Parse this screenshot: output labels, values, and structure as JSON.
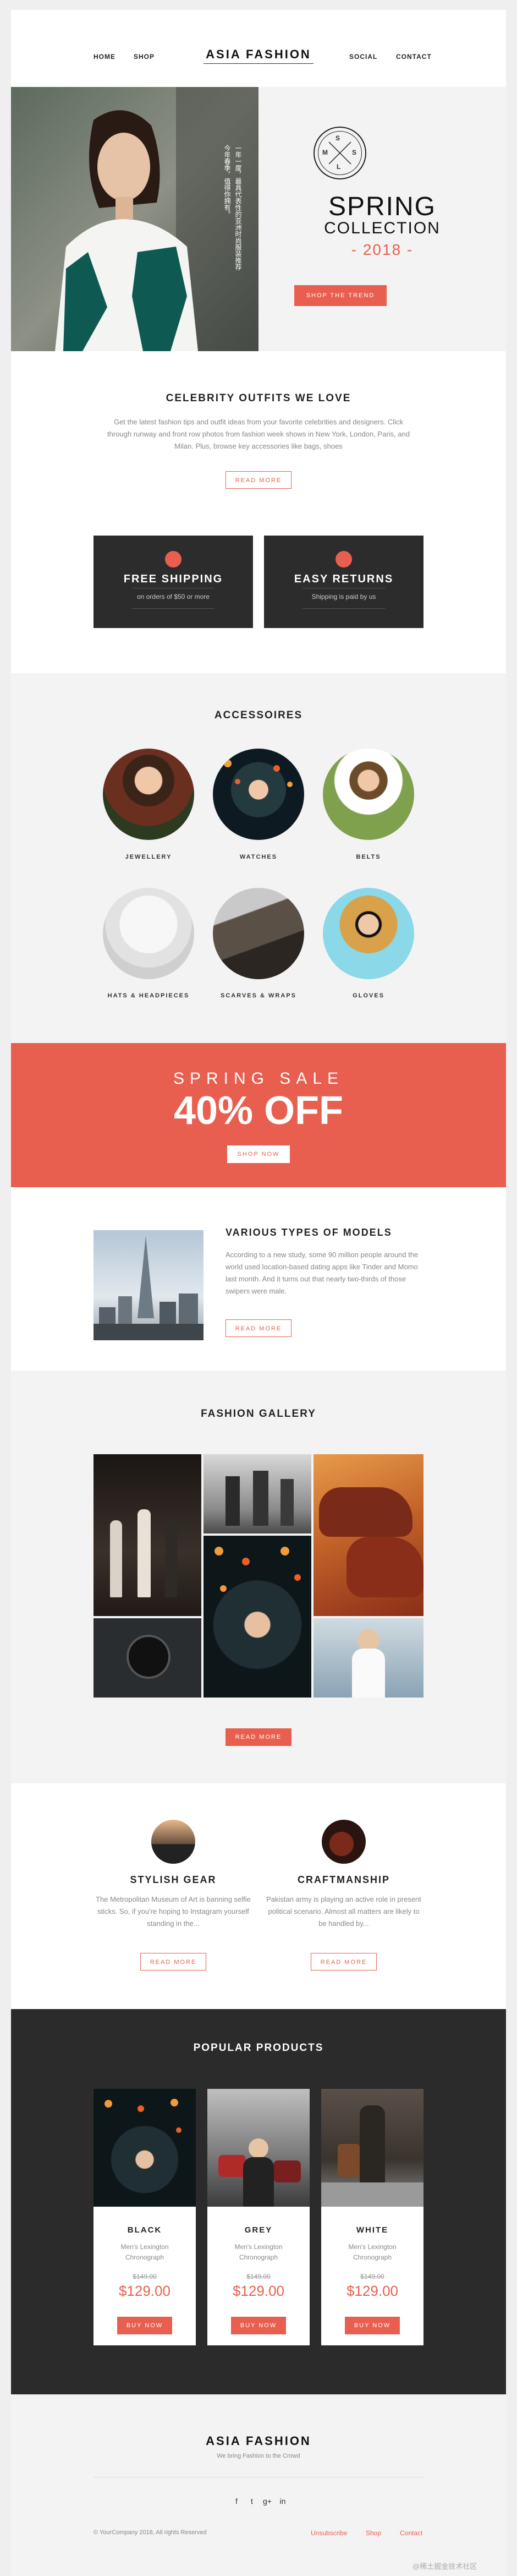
{
  "header": {
    "brand": "ASIA FASHION",
    "nav_left": [
      "HOME",
      "SHOP"
    ],
    "nav_right": [
      "SOCIAL",
      "CONTACT"
    ]
  },
  "hero": {
    "vertical_text_1": "一年一度，最具代表性的亚洲时尚服装推荐",
    "vertical_text_2": "今年春季，值得你拥有。",
    "logo_letters": [
      "S",
      "M",
      "S",
      "L"
    ],
    "title_1": "SPRING",
    "title_2": "COLLECTION",
    "year": "- 2018 -",
    "button": "SHOP THE TREND"
  },
  "celebrity": {
    "title": "CELEBRITY OUTFITS WE LOVE",
    "text": "Get the latest fashion tips and outfit ideas from your favorite celebrities and designers. Click through runway and front row photos from fashion week shows in New York, London, Paris, and Milan. Plus, browse key accessories like bags, shoes",
    "button": "READ MORE"
  },
  "features": [
    {
      "title": "FREE SHIPPING",
      "subtitle": "on orders of $50 or more"
    },
    {
      "title": "EASY RETURNS",
      "subtitle": "Shipping is paid by us"
    }
  ],
  "accessories": {
    "title": "ACCESSOIRES",
    "items": [
      "JEWELLERY",
      "WATCHES",
      "BELTS",
      "HATS & HEADPIECES",
      "SCARVES & WRAPS",
      "GLOVES"
    ]
  },
  "sale": {
    "label": "SPRING SALE",
    "headline": "40% OFF",
    "button": "SHOP NOW"
  },
  "models": {
    "title": "VARIOUS TYPES OF MODELS",
    "text": "According to a new study, some 90 million people around the world used location-based dating apps like Tinder and Momo last month. And it turns out that nearly two-thirds of those swipers were male.",
    "button": "READ MORE"
  },
  "gallery": {
    "title": "FASHION GALLERY",
    "button": "READ MORE"
  },
  "columns": [
    {
      "title": "STYLISH GEAR",
      "text": "The Metropolitan Museum of Art is banning selfie sticks. So, if you're hoping to Instagram yourself standing in the...",
      "button": "READ MORE"
    },
    {
      "title": "CRAFTMANSHIP",
      "text": "Pakistan army is playing an active role in present political scenario. Almost all matters are likely to be handled by...",
      "button": "READ MORE"
    }
  ],
  "products": {
    "title": "POPULAR PRODUCTS",
    "items": [
      {
        "name": "BLACK",
        "desc": "Men's Lexington Chronograph",
        "old": "$149.00",
        "price": "$129.00",
        "button": "BUY NOW"
      },
      {
        "name": "GREY",
        "desc": "Men's Lexington Chronograph",
        "old": "$149.00",
        "price": "$129.00",
        "button": "BUY NOW"
      },
      {
        "name": "WHITE",
        "desc": "Men's Lexington Chronograph",
        "old": "$149.00",
        "price": "$129.00",
        "button": "BUY NOW"
      }
    ]
  },
  "footer": {
    "brand": "ASIA FASHION",
    "tagline": "We bring Fashion to the Crowd",
    "social": [
      "f",
      "t",
      "g+",
      "in"
    ],
    "copyright": "© YourCompany 2018, All rights Reserved",
    "links": [
      "Unsubscribe",
      "Shop",
      "Contact"
    ]
  },
  "watermark": "@稀土掘金技术社区",
  "colors": {
    "accent": "#e85f4f",
    "dark": "#2b2b2b"
  }
}
